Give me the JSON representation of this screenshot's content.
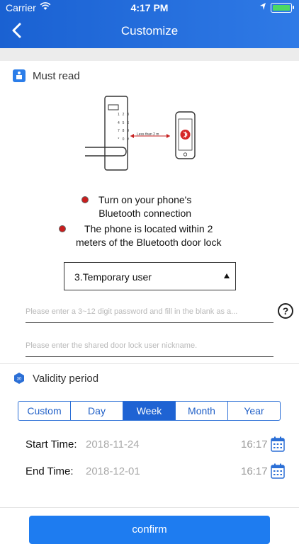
{
  "status_bar": {
    "carrier": "Carrier",
    "time": "4:17 PM"
  },
  "header": {
    "title": "Customize"
  },
  "must_read": {
    "title": "Must read",
    "illustration_label": "Less than 2 m",
    "keypad": [
      "1",
      "2",
      "3",
      "4",
      "5",
      "6",
      "7",
      "8",
      "9",
      "*",
      "0",
      "#"
    ],
    "bullets": [
      {
        "line1": "Turn on your phone's",
        "line2": "Bluetooth connection"
      },
      {
        "line1": "The phone is located within 2",
        "line2": "meters of the Bluetooth door lock"
      }
    ]
  },
  "user_type": {
    "selected": "3.Temporary user"
  },
  "password_field": {
    "placeholder": "Please enter a 3~12 digit password and fill in the blank as a..."
  },
  "nickname_field": {
    "placeholder": "Please enter the shared door lock user nickname."
  },
  "help": {
    "symbol": "?"
  },
  "validity": {
    "title": "Validity period",
    "icon_text": "30",
    "tabs": [
      "Custom",
      "Day",
      "Week",
      "Month",
      "Year"
    ],
    "active_tab": "Week",
    "start": {
      "label": "Start Time:",
      "date": "2018-11-24",
      "time": "16:17"
    },
    "end": {
      "label": "End Time:",
      "date": "2018-12-01",
      "time": "16:17"
    }
  },
  "confirm": {
    "label": "confirm"
  },
  "colors": {
    "header": "#1a61d2",
    "accent": "#1f63d3",
    "bullet": "#c91d1d",
    "battery": "#4cd964"
  }
}
